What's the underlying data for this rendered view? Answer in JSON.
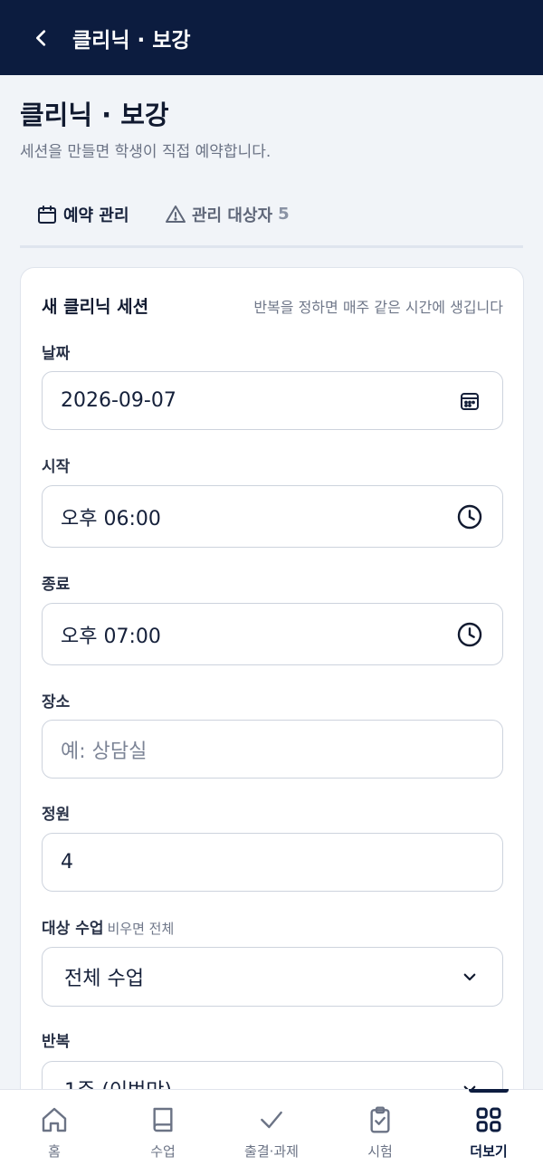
{
  "header": {
    "title": "클리닉 · 보강"
  },
  "page": {
    "title": "클리닉 · 보강",
    "subtitle": "세션을 만들면 학생이 직접 예약합니다."
  },
  "tabs": [
    {
      "label": "예약 관리",
      "icon": "calendar-icon",
      "active": true
    },
    {
      "label": "관리 대상자",
      "count": "5",
      "icon": "warning-icon",
      "active": false
    }
  ],
  "form": {
    "title": "새 클리닉 세션",
    "hint": "반복을 정하면 매주 같은 시간에 생깁니다",
    "date": {
      "label": "날짜",
      "value": "2026-09-07"
    },
    "start": {
      "label": "시작",
      "value": "오후 06:00"
    },
    "end": {
      "label": "종료",
      "value": "오후 07:00"
    },
    "place": {
      "label": "장소",
      "placeholder": "예: 상담실"
    },
    "capacity": {
      "label": "정원",
      "value": "4"
    },
    "target": {
      "label": "대상 수업",
      "hint": "비우면 전체",
      "selected": "전체 수업"
    },
    "repeat": {
      "label": "반복",
      "selected": "1주 (이번만)"
    }
  },
  "nav": [
    {
      "label": "홈",
      "icon": "home-icon"
    },
    {
      "label": "수업",
      "icon": "book-icon"
    },
    {
      "label": "출결·과제",
      "icon": "check-icon"
    },
    {
      "label": "시험",
      "icon": "clipboard-check-icon"
    },
    {
      "label": "더보기",
      "icon": "grid-icon",
      "active": true
    }
  ],
  "colors": {
    "header_bg": "#0c1c3f",
    "page_bg": "#f1f4f8",
    "accent": "#0c1c3f"
  }
}
